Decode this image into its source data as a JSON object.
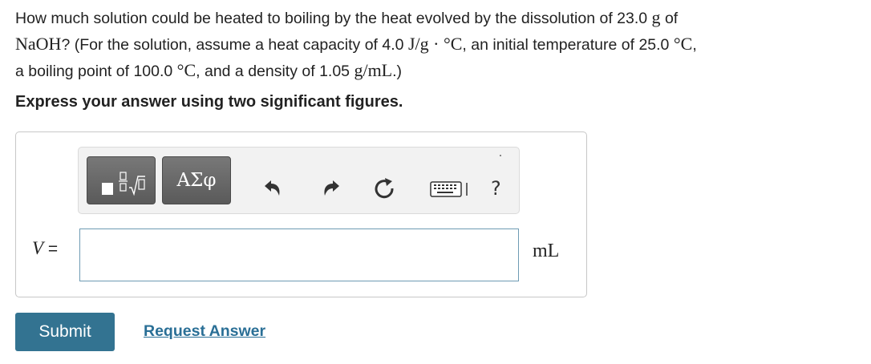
{
  "question": {
    "t1": "How much solution could be heated to boiling by the heat evolved by the dissolution of 23.0 ",
    "m1": "g",
    "t2": " of",
    "m2": "NaOH",
    "t3": "? (For the solution, assume a heat capacity of 4.0 ",
    "m3": "J/g · °C",
    "t4": ", an initial temperature of 25.0 ",
    "m4": "°C",
    "t5": ",",
    "t6": "a boiling point of 100.0 ",
    "m5": "°C",
    "t7": ", and a density of 1.05 ",
    "m6": "g/mL",
    "t8": ".)"
  },
  "instruction": "Express your answer using two significant figures.",
  "toolbar": {
    "greek_label": "ΑΣφ",
    "help_label": "?",
    "icons": [
      "templates-icon",
      "greek-letters-icon",
      "undo-icon",
      "redo-icon",
      "reset-icon",
      "keyboard-icon",
      "help-icon"
    ]
  },
  "answer": {
    "variable": "V",
    "equals": " =",
    "value": "",
    "unit": "mL"
  },
  "actions": {
    "submit_label": "Submit",
    "request_label": "Request Answer"
  },
  "colors": {
    "submit_bg": "#337391",
    "link": "#2a6f96",
    "input_border": "#6e9bb3"
  }
}
